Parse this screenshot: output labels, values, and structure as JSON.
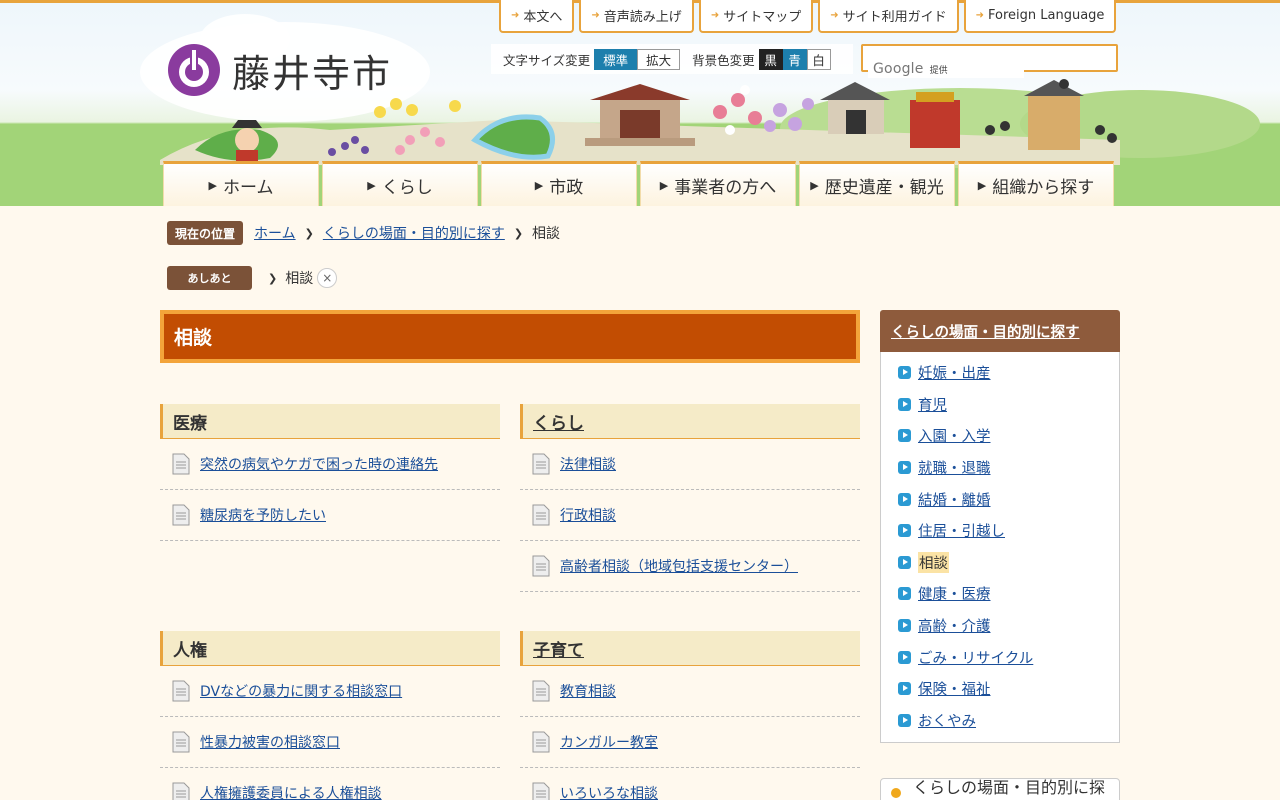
{
  "site": {
    "name": "藤井寺市"
  },
  "util_nav": [
    {
      "label": "本文へ"
    },
    {
      "label": "音声読み上げ"
    },
    {
      "label": "サイトマップ"
    },
    {
      "label": "サイト利用ガイド"
    },
    {
      "label": "Foreign Language"
    }
  ],
  "font_size": {
    "label": "文字サイズ変更",
    "standard": "標準",
    "large": "拡大"
  },
  "bg_color": {
    "label": "背景色変更",
    "black": "黒",
    "blue": "青",
    "white": "白"
  },
  "search": {
    "value": "",
    "google_label": "Google",
    "provided_label": "提供"
  },
  "main_nav": [
    {
      "label": "ホーム"
    },
    {
      "label": "くらし"
    },
    {
      "label": "市政"
    },
    {
      "label": "事業者の方へ"
    },
    {
      "label": "歴史遺産・観光"
    },
    {
      "label": "組織から探す"
    }
  ],
  "breadcrumb": {
    "tag": "現在の位置",
    "items": [
      "ホーム",
      "くらしの場面・目的別に探す"
    ],
    "current": "相談"
  },
  "ashiato": {
    "tag": "あしあと",
    "item": "相談",
    "close": "×"
  },
  "page": {
    "title": "相談"
  },
  "categories": [
    {
      "title": "医療",
      "items": [
        "突然の病気やケガで困った時の連絡先",
        "糖尿病を予防したい"
      ]
    },
    {
      "title": "くらし",
      "items": [
        "法律相談",
        "行政相談",
        "高齢者相談（地域包括支援センター）"
      ]
    },
    {
      "title": "人権",
      "items": [
        "DVなどの暴力に関する相談窓口",
        "性暴力被害の相談窓口",
        "人権擁護委員による人権相談"
      ]
    },
    {
      "title": "子育て",
      "items": [
        "教育相談",
        "カンガルー教室",
        "いろいろな相談"
      ]
    }
  ],
  "sidebar": {
    "title": "くらしの場面・目的別に探す",
    "items": [
      "妊娠・出産",
      "育児",
      "入園・入学",
      "就職・退職",
      "結婚・離婚",
      "住居・引越し",
      "相談",
      "健康・医療",
      "高齢・介護",
      "ごみ・リサイクル",
      "保険・福祉",
      "おくやみ"
    ],
    "current": "相談"
  },
  "banner": {
    "label": "くらしの場面・目的別に探す"
  },
  "colors": {
    "accent": "#e8a33c",
    "title_bg": "#c24d02",
    "brand_brown": "#8e5b3c",
    "link": "#1b4f99"
  }
}
